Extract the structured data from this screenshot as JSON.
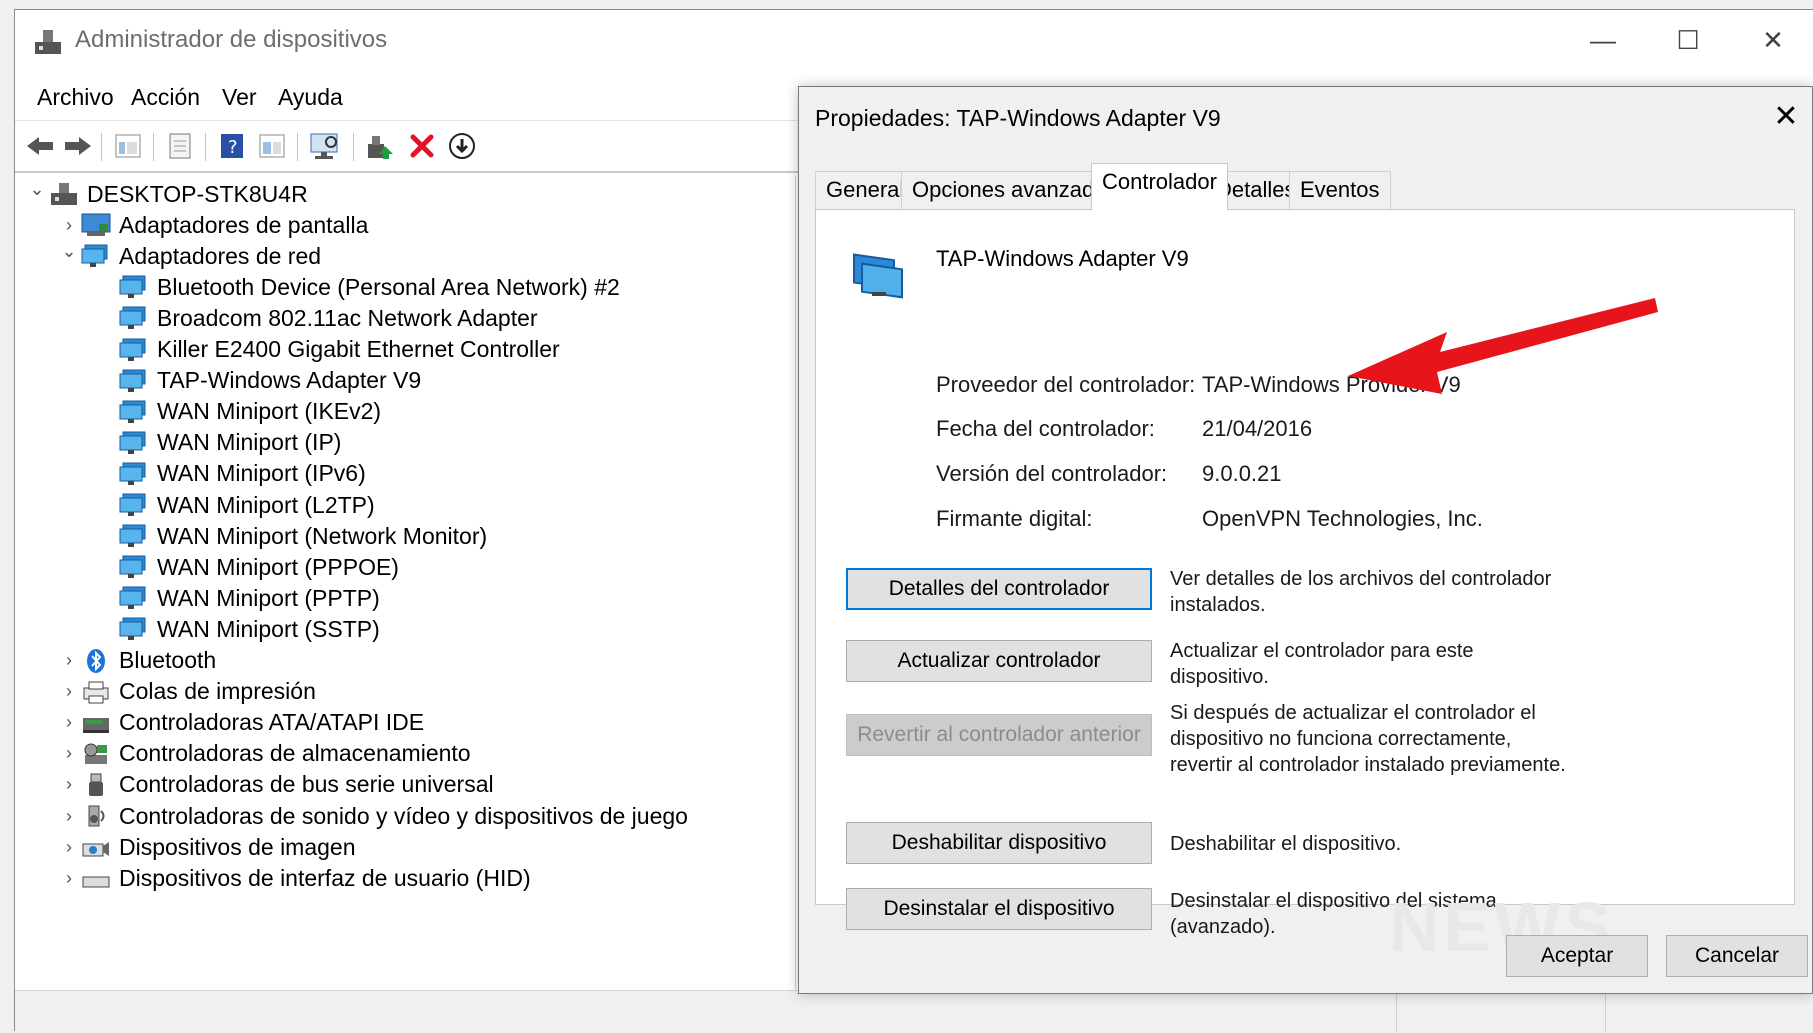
{
  "main_window": {
    "title": "Administrador de dispositivos",
    "menu": [
      "Archivo",
      "Acción",
      "Ver",
      "Ayuda"
    ],
    "tree": {
      "root": "DESKTOP-STK8U4R",
      "items": [
        {
          "label": "Adaptadores de pantalla",
          "expanded": false,
          "icon": "display-adapter-icon"
        },
        {
          "label": "Adaptadores de red",
          "expanded": true,
          "icon": "network-adapter-icon"
        },
        {
          "label": "Bluetooth Device (Personal Area Network) #2",
          "child": true,
          "icon": "network-adapter-icon"
        },
        {
          "label": "Broadcom 802.11ac Network Adapter",
          "child": true,
          "icon": "network-adapter-icon"
        },
        {
          "label": "Killer E2400 Gigabit Ethernet Controller",
          "child": true,
          "icon": "network-adapter-icon"
        },
        {
          "label": "TAP-Windows Adapter V9",
          "child": true,
          "icon": "network-adapter-icon"
        },
        {
          "label": "WAN Miniport (IKEv2)",
          "child": true,
          "icon": "network-adapter-icon"
        },
        {
          "label": "WAN Miniport (IP)",
          "child": true,
          "icon": "network-adapter-icon"
        },
        {
          "label": "WAN Miniport (IPv6)",
          "child": true,
          "icon": "network-adapter-icon"
        },
        {
          "label": "WAN Miniport (L2TP)",
          "child": true,
          "icon": "network-adapter-icon"
        },
        {
          "label": "WAN Miniport (Network Monitor)",
          "child": true,
          "icon": "network-adapter-icon"
        },
        {
          "label": "WAN Miniport (PPPOE)",
          "child": true,
          "icon": "network-adapter-icon"
        },
        {
          "label": "WAN Miniport (PPTP)",
          "child": true,
          "icon": "network-adapter-icon"
        },
        {
          "label": "WAN Miniport (SSTP)",
          "child": true,
          "icon": "network-adapter-icon"
        },
        {
          "label": "Bluetooth",
          "expanded": false,
          "icon": "bluetooth-icon"
        },
        {
          "label": "Colas de impresión",
          "expanded": false,
          "icon": "printer-icon"
        },
        {
          "label": "Controladoras ATA/ATAPI IDE",
          "expanded": false,
          "icon": "ide-controller-icon"
        },
        {
          "label": "Controladoras de almacenamiento",
          "expanded": false,
          "icon": "storage-controller-icon"
        },
        {
          "label": "Controladoras de bus serie universal",
          "expanded": false,
          "icon": "usb-icon"
        },
        {
          "label": "Controladoras de sonido y vídeo y dispositivos de juego",
          "expanded": false,
          "icon": "speaker-icon"
        },
        {
          "label": "Dispositivos de imagen",
          "expanded": false,
          "icon": "camera-icon"
        },
        {
          "label": "Dispositivos de interfaz de usuario (HID)",
          "expanded": false,
          "icon": "hid-icon"
        }
      ]
    }
  },
  "dialog": {
    "title": "Propiedades: TAP-Windows Adapter V9",
    "tabs": [
      "General",
      "Opciones avanzadas",
      "Controlador",
      "Detalles",
      "Eventos"
    ],
    "active_tab": "Controlador",
    "device_name": "TAP-Windows Adapter V9",
    "fields": [
      {
        "key": "Proveedor del controlador:",
        "value": "TAP-Windows Provider V9"
      },
      {
        "key": "Fecha del controlador:",
        "value": "21/04/2016"
      },
      {
        "key": "Versión del controlador:",
        "value": "9.0.0.21"
      },
      {
        "key": "Firmante digital:",
        "value": "OpenVPN Technologies, Inc."
      }
    ],
    "actions": [
      {
        "label": "Detalles del controlador",
        "desc": "Ver detalles de los archivos del controlador instalados.",
        "state": "focused"
      },
      {
        "label": "Actualizar controlador",
        "desc": "Actualizar el controlador para este dispositivo.",
        "state": "normal"
      },
      {
        "label": "Revertir al controlador anterior",
        "desc": "Si después de actualizar el controlador el dispositivo no funciona correctamente, revertir al controlador instalado previamente.",
        "state": "disabled"
      },
      {
        "label": "Deshabilitar dispositivo",
        "desc": "Deshabilitar el dispositivo.",
        "state": "normal"
      },
      {
        "label": "Desinstalar el dispositivo",
        "desc": "Desinstalar el dispositivo del sistema (avanzado).",
        "state": "normal"
      }
    ],
    "ok_label": "Aceptar",
    "cancel_label": "Cancelar",
    "watermark": "NEWS"
  },
  "colors": {
    "accent": "#0078d7",
    "arrow": "#e8141b",
    "delete": "#e81123",
    "network": "#1e6fc4"
  }
}
